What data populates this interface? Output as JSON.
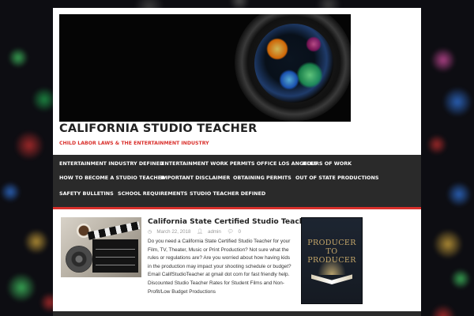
{
  "site": {
    "title": "CALIFORNIA STUDIO TEACHER",
    "tagline": "CHILD LABOR LAWS & THE ENTERTAINMENT INDUSTRY"
  },
  "colors": {
    "accent": "#d9302c",
    "nav_bg": "#2a2a2a",
    "page_bg": "#ffffff",
    "body_bg": "#0d0d12"
  },
  "nav": {
    "row1": [
      "ENTERTAINMENT INDUSTRY DEFINED",
      "ENTERTAINMENT WORK PERMITS OFFICE LOS ANGELES",
      "HOURS OF WORK"
    ],
    "row2": [
      "HOW TO BECOME A STUDIO TEACHER",
      "IMPORTANT DISCLAIMER",
      "OBTAINING PERMITS",
      "OUT OF STATE PRODUCTIONS"
    ],
    "row3": [
      "SAFETY BULLETINS",
      "SCHOOL REQUIREMENTS",
      "STUDIO TEACHER DEFINED"
    ]
  },
  "post": {
    "title": "California State Certified Studio Teacher",
    "date": "March 22, 2018",
    "author": "admin",
    "comments": "0",
    "excerpt": "Do you need a California State Certified Studio Teacher for your Film, TV, Theater, Music or Print Production? Not sure what the rules or regulations are? Are you worried about how having kids in the production may impact your shooting schedule or budget? Email CalifStudioTeacher at gmail dot com for fast friendly help.   Discounted Studio Teacher Rates for Student Films and Non-Profit/Low Budget Productions",
    "icons": {
      "date": "clock-icon",
      "author": "user-icon",
      "comments": "comment-icon"
    }
  },
  "sidebar": {
    "book_title_line1": "PRODUCER TO",
    "book_title_line2": "PRODUCER"
  }
}
